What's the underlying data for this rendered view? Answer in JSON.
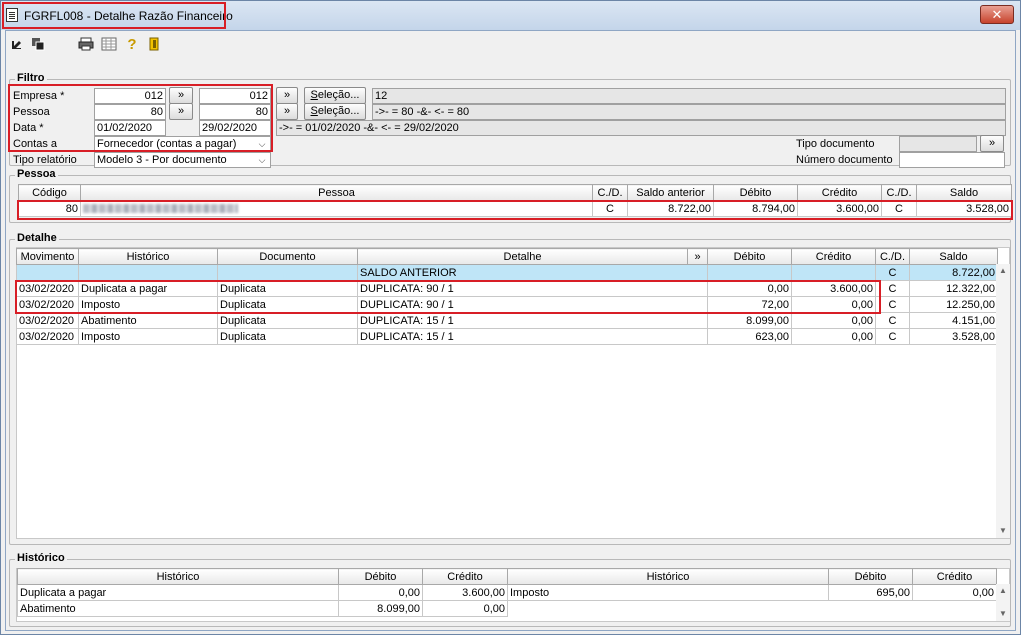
{
  "window": {
    "title": "FGRFL008 - Detalhe Razão Financeiro",
    "close_label": "✕"
  },
  "toolbar": {
    "icons": [
      "export-icon",
      "copy-icon",
      "print-icon",
      "calculator-icon",
      "help-icon",
      "exit-icon"
    ]
  },
  "filtro": {
    "title": "Filtro",
    "empresa": {
      "label": "Empresa *",
      "from": "012",
      "to": "012"
    },
    "pessoa": {
      "label": "Pessoa",
      "from": "80",
      "to": "80"
    },
    "data": {
      "label": "Data *",
      "from": "01/02/2020",
      "to": "29/02/2020"
    },
    "contas": {
      "label": "Contas a",
      "value": "Fornecedor (contas a pagar)"
    },
    "tipo_relatorio": {
      "label": "Tipo relatório",
      "value": "Modelo 3 - Por documento"
    },
    "arrow_label": "»",
    "selecao_label_prefix": "S",
    "selecao_label_rest": "eleção...",
    "selecao_empresa_value": "12",
    "selecao_pessoa_value": "->- = 80  -&- <- = 80",
    "data_expr": "->- = 01/02/2020  -&- <- = 29/02/2020",
    "tipo_documento_label": "Tipo documento",
    "numero_documento_label": "Número documento",
    "tipo_documento_value": "",
    "numero_documento_value": ""
  },
  "pessoa_section": {
    "title": "Pessoa",
    "columns": [
      "Código",
      "Pessoa",
      "C./D.",
      "Saldo anterior",
      "Débito",
      "Crédito",
      "C./D.",
      "Saldo"
    ],
    "row": {
      "codigo": "80",
      "cd1": "C",
      "saldo_anterior": "8.722,00",
      "debito": "8.794,00",
      "credito": "3.600,00",
      "cd2": "C",
      "saldo": "3.528,00"
    }
  },
  "detalhe": {
    "title": "Detalhe",
    "columns": [
      "Movimento",
      "Histórico",
      "Documento",
      "Detalhe",
      "»",
      "Débito",
      "Crédito",
      "C./D.",
      "Saldo"
    ],
    "saldo_anterior_row": {
      "detalhe": "SALDO ANTERIOR",
      "cd": "C",
      "saldo": "8.722,00"
    },
    "rows": [
      {
        "movimento": "03/02/2020",
        "historico": "Duplicata a pagar",
        "documento": "Duplicata",
        "detalhe": "DUPLICATA: 90 / 1",
        "debito": "0,00",
        "credito": "3.600,00",
        "cd": "C",
        "saldo": "12.322,00"
      },
      {
        "movimento": "03/02/2020",
        "historico": "Imposto",
        "documento": "Duplicata",
        "detalhe": "DUPLICATA: 90 / 1",
        "debito": "72,00",
        "credito": "0,00",
        "cd": "C",
        "saldo": "12.250,00"
      },
      {
        "movimento": "03/02/2020",
        "historico": "Abatimento",
        "documento": "Duplicata",
        "detalhe": "DUPLICATA: 15 / 1",
        "debito": "8.099,00",
        "credito": "0,00",
        "cd": "C",
        "saldo": "4.151,00"
      },
      {
        "movimento": "03/02/2020",
        "historico": "Imposto",
        "documento": "Duplicata",
        "detalhe": "DUPLICATA: 15 / 1",
        "debito": "623,00",
        "credito": "0,00",
        "cd": "C",
        "saldo": "3.528,00"
      }
    ]
  },
  "historico": {
    "title": "Histórico",
    "columns": [
      "Histórico",
      "Débito",
      "Crédito",
      "Histórico",
      "Débito",
      "Crédito"
    ],
    "left_rows": [
      {
        "historico": "Duplicata a pagar",
        "debito": "0,00",
        "credito": "3.600,00"
      },
      {
        "historico": "Abatimento",
        "debito": "8.099,00",
        "credito": "0,00"
      }
    ],
    "right_rows": [
      {
        "historico": "Imposto",
        "debito": "695,00",
        "credito": "0,00"
      }
    ]
  }
}
